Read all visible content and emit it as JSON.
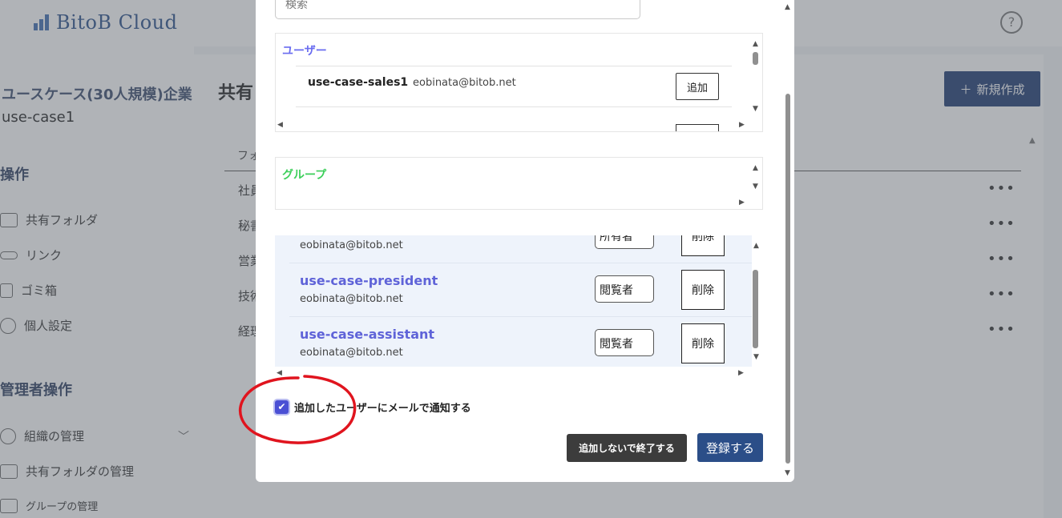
{
  "app": {
    "brand": "BitoB Cloud",
    "help_symbol": "?"
  },
  "sidebar": {
    "org_name": "ユースケース(30人規模)企業",
    "org_id": "use-case1",
    "section_ops": "操作",
    "ops_items": [
      {
        "label": "共有フォルダ",
        "icon": "folder-user-icon"
      },
      {
        "label": "リンク",
        "icon": "link-icon"
      },
      {
        "label": "ゴミ箱",
        "icon": "trash-icon"
      },
      {
        "label": "個人設定",
        "icon": "gear-icon"
      }
    ],
    "section_admin": "管理者操作",
    "admin_items": [
      {
        "label": "組織の管理",
        "icon": "gear-icon"
      },
      {
        "label": "共有フォルダの管理",
        "icon": "folder-icon"
      },
      {
        "label": "グループの管理",
        "icon": "group-icon"
      }
    ]
  },
  "main": {
    "title": "共有",
    "new_button": "新規作成",
    "column_header": "フォ",
    "rows": [
      "社員",
      "秘書",
      "営業",
      "技術",
      "経理"
    ],
    "row_menu": "•••"
  },
  "modal": {
    "search_placeholder": "検索",
    "users_label": "ユーザー",
    "users": [
      {
        "name": "use-case-sales1",
        "email": "eobinata@bitob.net",
        "action": "追加"
      }
    ],
    "groups_label": "グループ",
    "members": [
      {
        "name": "",
        "email": "eobinata@bitob.net",
        "role": "所有者",
        "action": "削除"
      },
      {
        "name": "use-case-president",
        "email": "eobinata@bitob.net",
        "role": "閲覧者",
        "action": "削除"
      },
      {
        "name": "use-case-assistant",
        "email": "eobinata@bitob.net",
        "role": "閲覧者",
        "action": "削除"
      }
    ],
    "notify_label": "追加したユーザーにメールで通知する",
    "notify_checked": true,
    "cancel_button": "追加しないで終了する",
    "submit_button": "登録する"
  },
  "colors": {
    "users_label": "#6a6df0",
    "groups_label": "#3ccf5a",
    "member_name": "#5f63d8",
    "primary_button": "#2b4e88",
    "annotation_circle": "#e0141e"
  }
}
